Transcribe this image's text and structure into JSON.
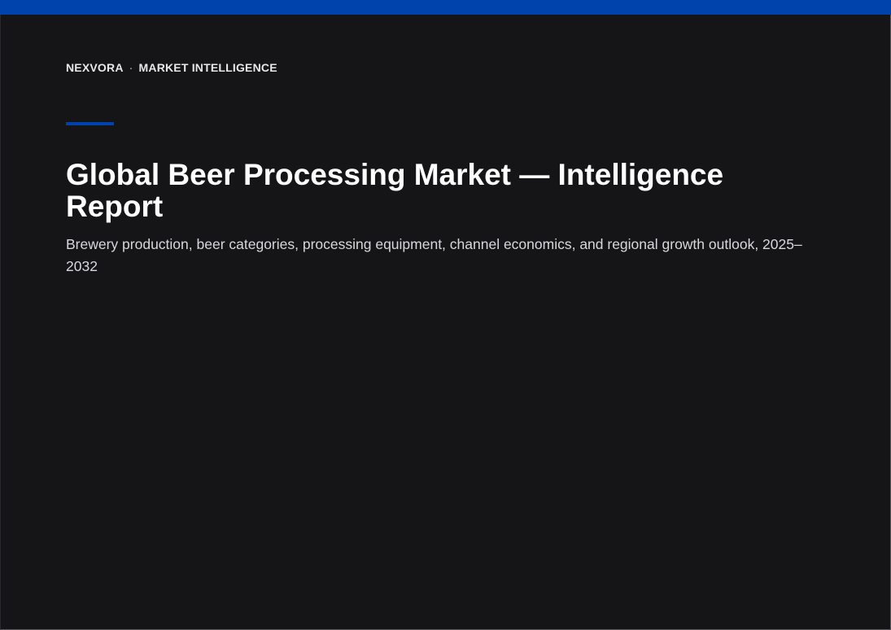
{
  "colors": {
    "accent": "#0043ac",
    "background": "#151517"
  },
  "header": {
    "brand": "NEXVORA",
    "separator": "·",
    "section": "MARKET INTELLIGENCE"
  },
  "cover": {
    "title": "Global Beer Processing Market — Intelligence Report",
    "subtitle": "Brewery production, beer categories, processing equipment, channel economics, and regional growth outlook, 2025–2032"
  }
}
